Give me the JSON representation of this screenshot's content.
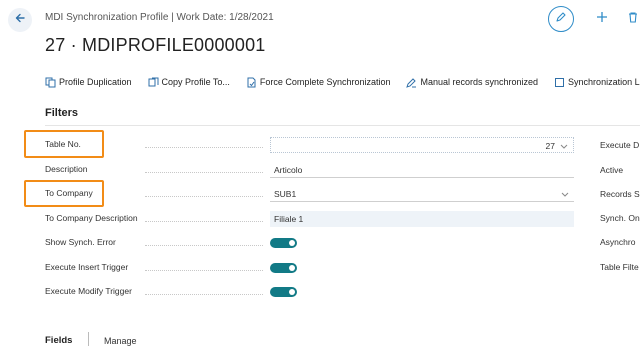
{
  "header": {
    "back_icon": "back-arrow-icon",
    "subtitle": "MDI Synchronization Profile | Work Date: 1/28/2021",
    "title": "27 · MDIPROFILE0000001",
    "edit_icon": "pencil-icon",
    "new_icon": "plus-icon",
    "delete_icon": "trash-icon"
  },
  "actions": [
    {
      "label": "Profile Duplication",
      "icon": "duplicate-icon"
    },
    {
      "label": "Copy Profile To...",
      "icon": "copy-icon"
    },
    {
      "label": "Force Complete Synchronization",
      "icon": "sync-document-icon"
    },
    {
      "label": "Manual records synchronized",
      "icon": "manual-edit-icon"
    },
    {
      "label": "Synchronization L",
      "icon": "log-icon"
    }
  ],
  "filters": {
    "title": "Filters",
    "table_no": {
      "label": "Table No.",
      "value": "27"
    },
    "description": {
      "label": "Description",
      "value": "Articolo"
    },
    "to_company": {
      "label": "To Company",
      "value": "SUB1"
    },
    "to_company_description": {
      "label": "To Company Description",
      "value": "Filiale 1"
    },
    "show_synch_error": {
      "label": "Show Synch. Error",
      "value": true
    },
    "execute_insert_trigger": {
      "label": "Execute Insert Trigger",
      "value": true
    },
    "execute_modify_trigger": {
      "label": "Execute Modify Trigger",
      "value": true
    },
    "right_column": [
      "Execute D",
      "Active",
      "Records S",
      "Synch. On",
      "Asynchro",
      "Table Filte"
    ]
  },
  "bottom_tabs": {
    "fields": "Fields",
    "manage": "Manage"
  },
  "colors": {
    "accent": "#2f8cc8",
    "toggle_on": "#127a86",
    "highlight": "#f28c17"
  }
}
